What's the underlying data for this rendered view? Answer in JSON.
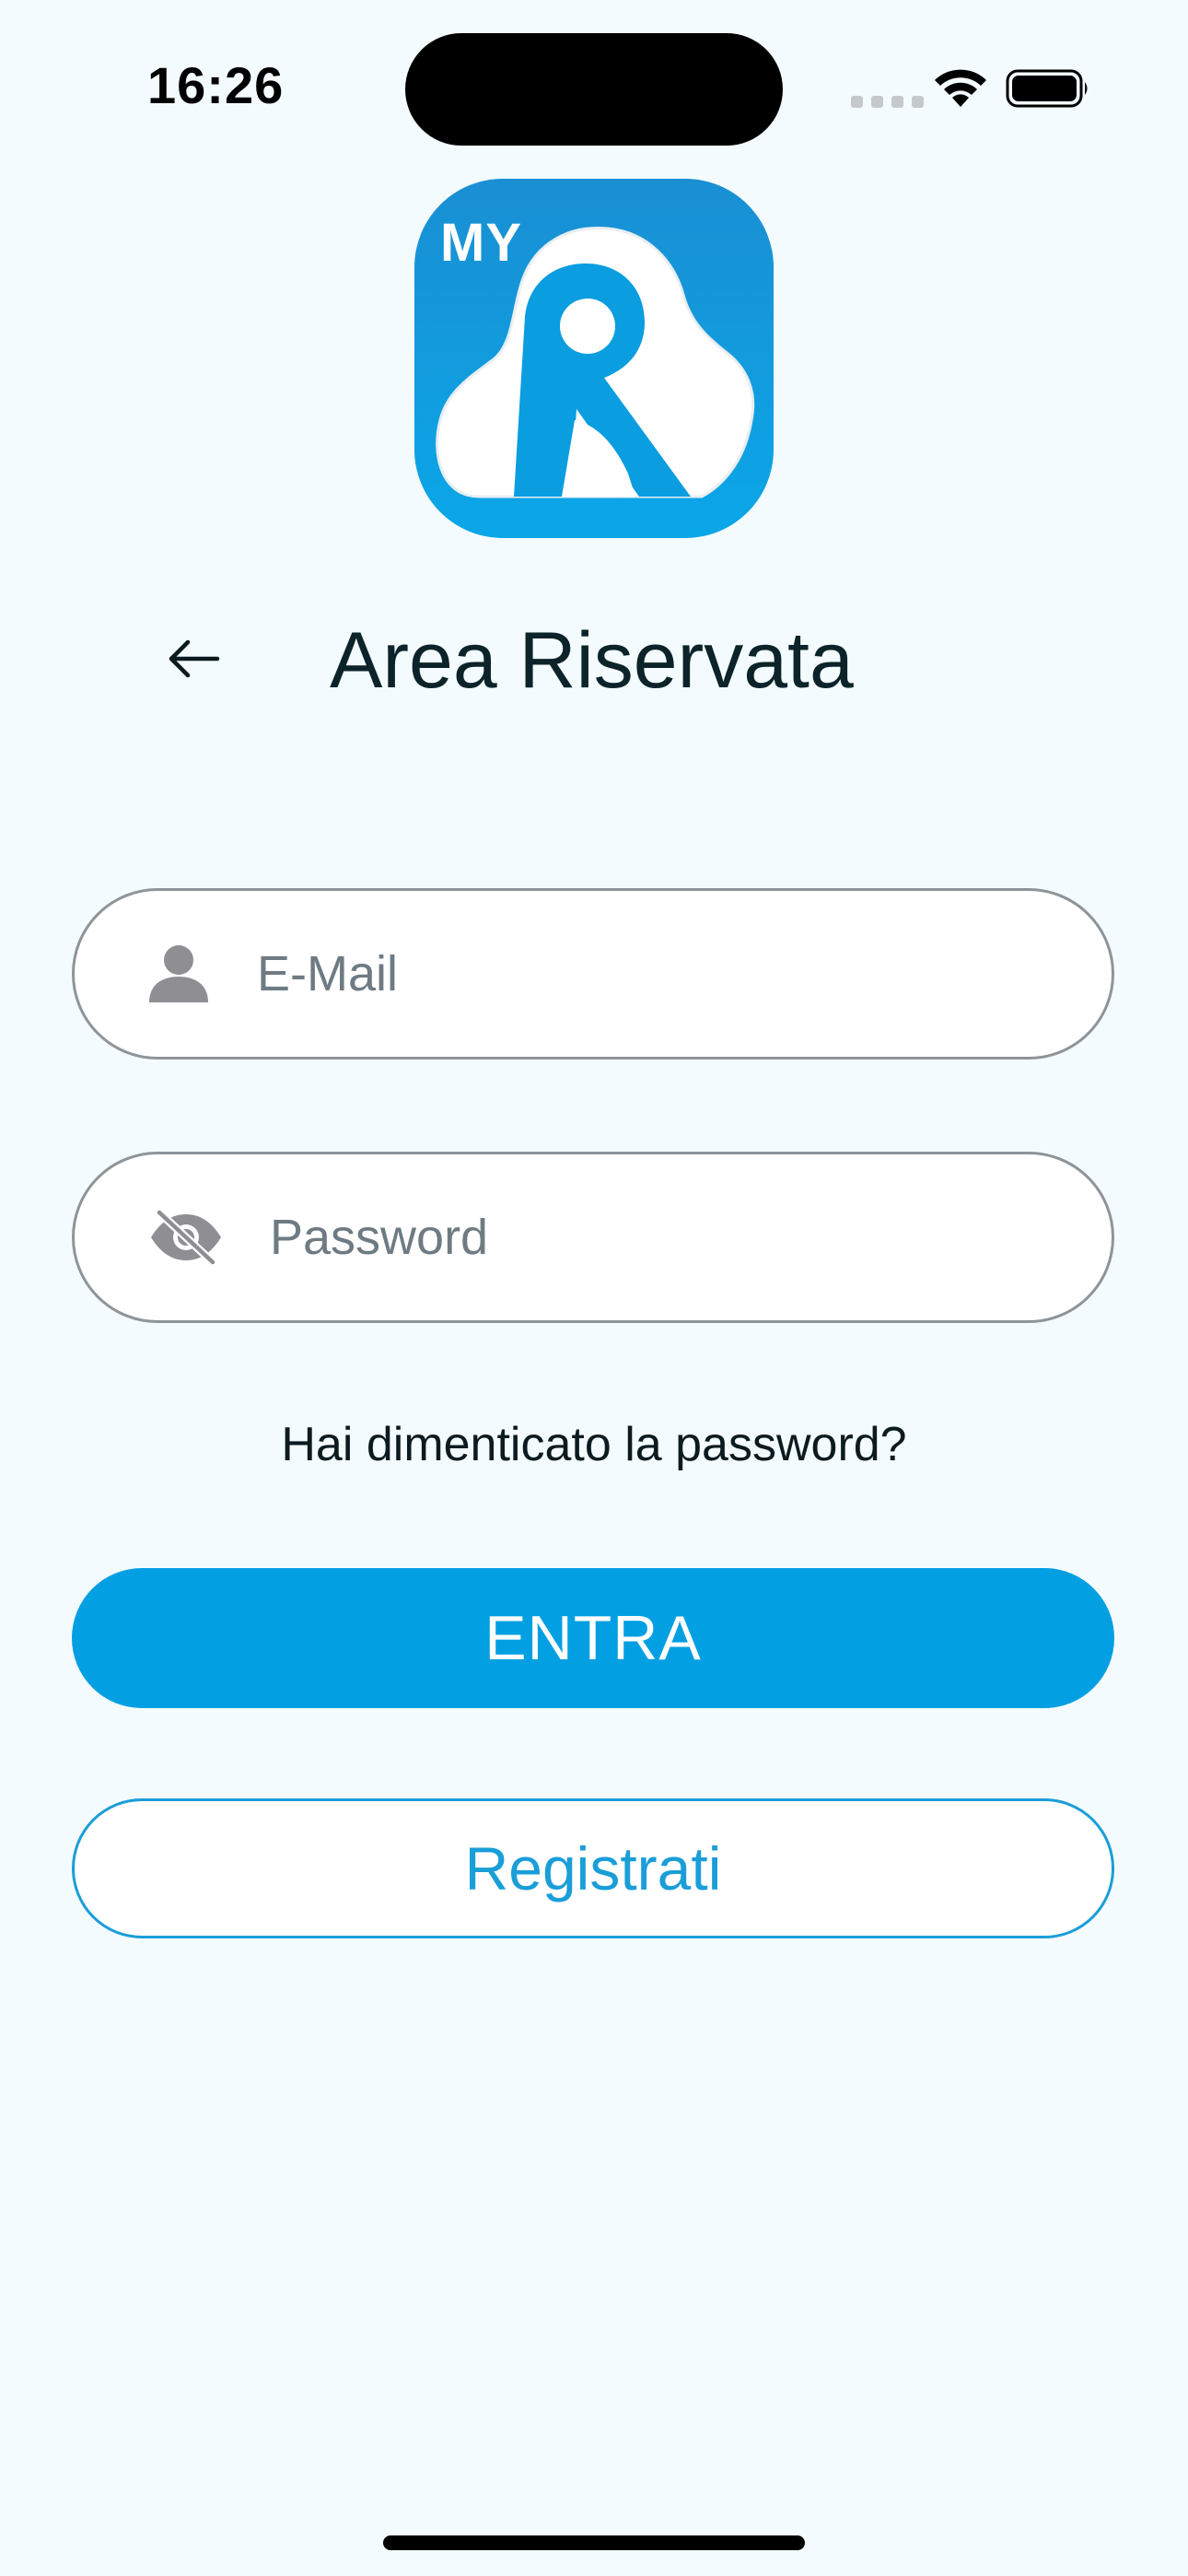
{
  "status_bar": {
    "time": "16:26"
  },
  "logo": {
    "badge_text": "MY",
    "icon": "myr-app-logo"
  },
  "header": {
    "back_icon": "arrow-left-icon",
    "title": "Area Riservata"
  },
  "form": {
    "email": {
      "placeholder": "E-Mail",
      "value": "",
      "icon": "person-icon"
    },
    "password": {
      "placeholder": "Password",
      "value": "",
      "icon": "eye-slash-icon"
    },
    "forgot_password_label": "Hai dimenticato la password?",
    "submit_label": "ENTRA",
    "register_label": "Registrati"
  },
  "colors": {
    "accent": "#039fe3",
    "background": "#f4fbfe",
    "title": "#0c2329"
  }
}
